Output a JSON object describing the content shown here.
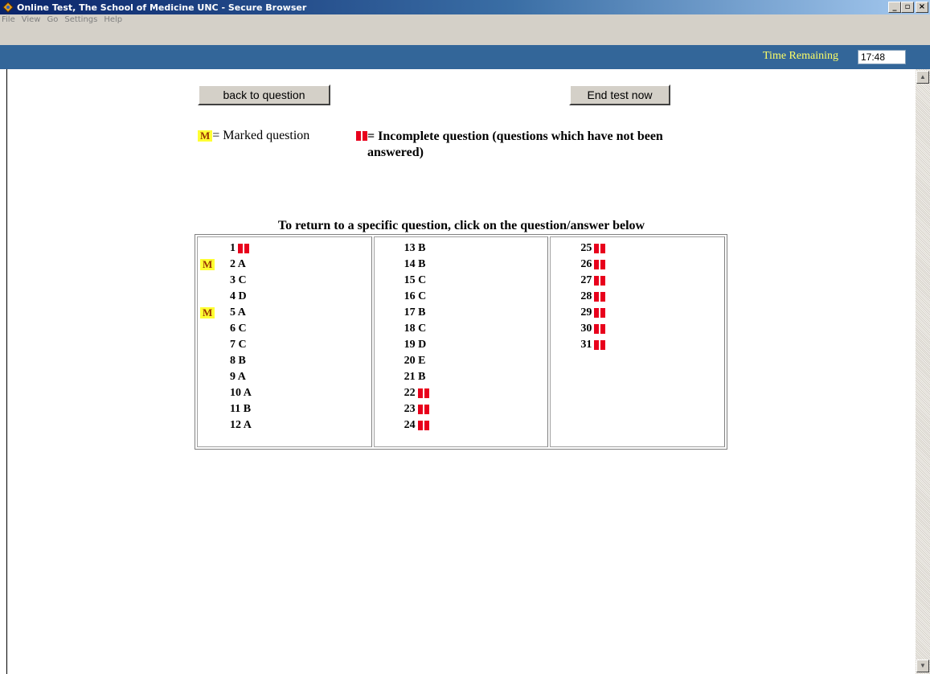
{
  "window": {
    "title": "Online Test, The School of Medicine UNC - Secure Browser",
    "controls": {
      "minimize": "_",
      "maximize": "▫",
      "close": "×"
    }
  },
  "menu": [
    "File",
    "View",
    "Go",
    "Settings",
    "Help"
  ],
  "timer": {
    "label": "Time Remaining",
    "value": "17:48"
  },
  "buttons": {
    "back": "back to question",
    "end": "End test now"
  },
  "legend": {
    "marked_badge": "M",
    "marked_text": "= Marked question",
    "incomplete_text": "= Incomplete question (questions which have not been answered)"
  },
  "instruction": "To return to a specific question, click on the question/answer below",
  "colors": {
    "header": "#336699",
    "timer_text": "#ffff66",
    "incomplete": "#e8001c",
    "marked_bg": "#ffff33"
  },
  "questions": {
    "col1": [
      {
        "label": "1",
        "marked": false,
        "incomplete": true
      },
      {
        "label": "2 A",
        "marked": true,
        "incomplete": false
      },
      {
        "label": "3 C",
        "marked": false,
        "incomplete": false
      },
      {
        "label": "4 D",
        "marked": false,
        "incomplete": false
      },
      {
        "label": "5 A",
        "marked": true,
        "incomplete": false
      },
      {
        "label": "6 C",
        "marked": false,
        "incomplete": false
      },
      {
        "label": "7 C",
        "marked": false,
        "incomplete": false
      },
      {
        "label": "8 B",
        "marked": false,
        "incomplete": false
      },
      {
        "label": "9 A",
        "marked": false,
        "incomplete": false
      },
      {
        "label": "10 A",
        "marked": false,
        "incomplete": false
      },
      {
        "label": "11 B",
        "marked": false,
        "incomplete": false
      },
      {
        "label": "12 A",
        "marked": false,
        "incomplete": false
      }
    ],
    "col2": [
      {
        "label": "13 B",
        "marked": false,
        "incomplete": false
      },
      {
        "label": "14 B",
        "marked": false,
        "incomplete": false
      },
      {
        "label": "15 C",
        "marked": false,
        "incomplete": false
      },
      {
        "label": "16 C",
        "marked": false,
        "incomplete": false
      },
      {
        "label": "17 B",
        "marked": false,
        "incomplete": false
      },
      {
        "label": "18 C",
        "marked": false,
        "incomplete": false
      },
      {
        "label": "19 D",
        "marked": false,
        "incomplete": false
      },
      {
        "label": "20 E",
        "marked": false,
        "incomplete": false
      },
      {
        "label": "21 B",
        "marked": false,
        "incomplete": false
      },
      {
        "label": "22",
        "marked": false,
        "incomplete": true
      },
      {
        "label": "23",
        "marked": false,
        "incomplete": true
      },
      {
        "label": "24",
        "marked": false,
        "incomplete": true
      }
    ],
    "col3": [
      {
        "label": "25",
        "marked": false,
        "incomplete": true
      },
      {
        "label": "26",
        "marked": false,
        "incomplete": true
      },
      {
        "label": "27",
        "marked": false,
        "incomplete": true
      },
      {
        "label": "28",
        "marked": false,
        "incomplete": true
      },
      {
        "label": "29",
        "marked": false,
        "incomplete": true
      },
      {
        "label": "30",
        "marked": false,
        "incomplete": true
      },
      {
        "label": "31",
        "marked": false,
        "incomplete": true
      }
    ]
  }
}
